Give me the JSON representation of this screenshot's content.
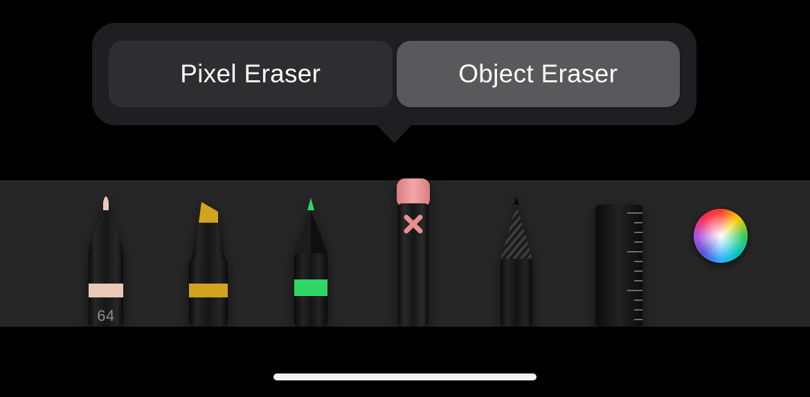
{
  "popover": {
    "options": [
      {
        "label": "Pixel Eraser",
        "selected": false
      },
      {
        "label": "Object Eraser",
        "selected": true
      }
    ]
  },
  "tools": {
    "pen": {
      "name": "pen",
      "size_label": "64",
      "accent": "#e8c9b8",
      "selected": false
    },
    "marker": {
      "name": "marker",
      "accent": "#d2a31f",
      "selected": false
    },
    "pencil": {
      "name": "pencil",
      "accent": "#2fd665",
      "selected": false
    },
    "eraser": {
      "name": "eraser",
      "cap": "#e88f90",
      "selected": true
    },
    "lasso": {
      "name": "lasso",
      "selected": false
    },
    "ruler": {
      "name": "ruler",
      "selected": false
    },
    "color_picker": {
      "name": "color-picker"
    }
  }
}
